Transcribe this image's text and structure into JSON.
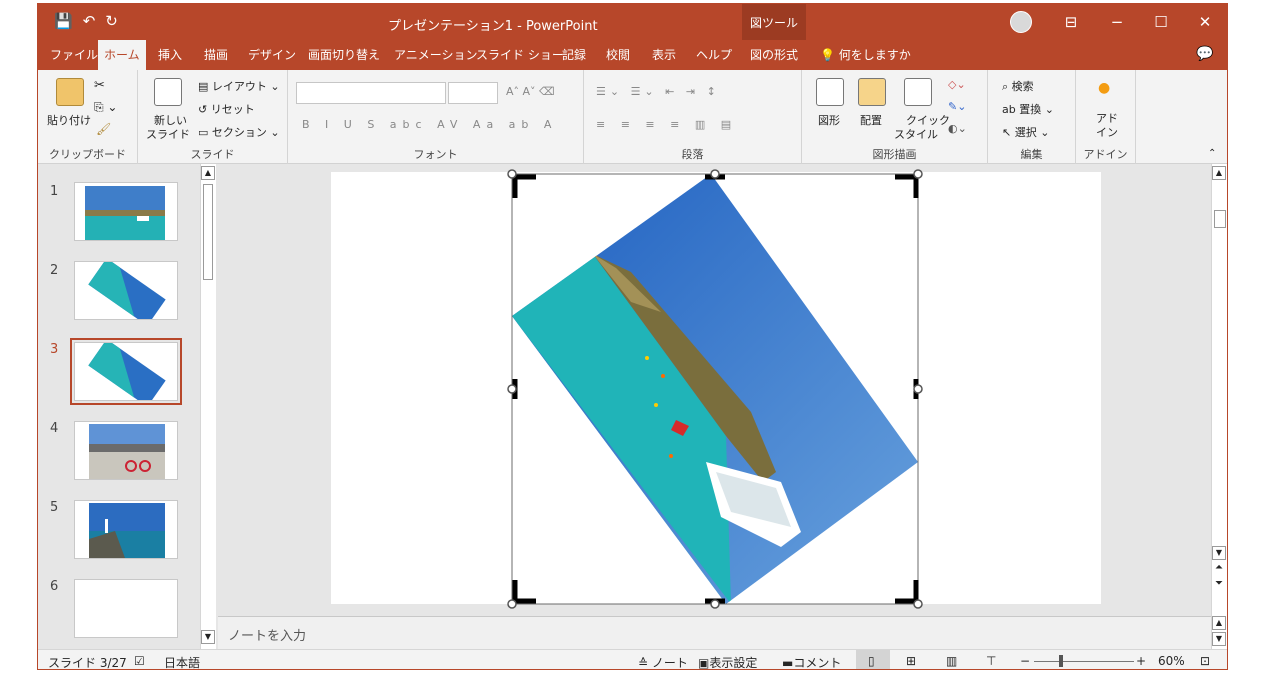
{
  "titlebar": {
    "doc_title": "プレゼンテーション1 - PowerPoint",
    "context_tab": "図ツール",
    "qat_save": "💾",
    "qat_undo": "↶",
    "qat_redo": "↻",
    "minimize": "−",
    "restore": "☐",
    "close": "✕",
    "display_options": "⊟"
  },
  "tabs": [
    "ファイル",
    "ホーム",
    "挿入",
    "描画",
    "デザイン",
    "画面切り替え",
    "アニメーション",
    "スライド ショー",
    "記録",
    "校閲",
    "表示",
    "ヘルプ",
    "図の形式"
  ],
  "active_tab": "ホーム",
  "tell_me": "何をしますか",
  "ribbon": {
    "clipboard": {
      "label": "クリップボード",
      "paste": "貼り付け"
    },
    "slides": {
      "label": "スライド",
      "new_slide_1": "新しい",
      "new_slide_2": "スライド",
      "layout": "レイアウト",
      "reset": "リセット",
      "section": "セクション"
    },
    "font": {
      "label": "フォント"
    },
    "paragraph": {
      "label": "段落"
    },
    "drawing": {
      "label": "図形描画",
      "shapes": "図形",
      "arrange": "配置",
      "quick_styles_1": "クイック",
      "quick_styles_2": "スタイル"
    },
    "editing": {
      "label": "編集",
      "find": "検索",
      "replace": "置換",
      "select": "選択"
    },
    "addins": {
      "label": "アドイン",
      "addin_1": "アド",
      "addin_2": "イン"
    }
  },
  "slides": [
    {
      "num": "1",
      "kind": "landscape"
    },
    {
      "num": "2",
      "kind": "rotated"
    },
    {
      "num": "3",
      "kind": "rotated"
    },
    {
      "num": "4",
      "kind": "bike"
    },
    {
      "num": "5",
      "kind": "lighthouse"
    },
    {
      "num": "6",
      "kind": "blank"
    }
  ],
  "selected_slide": 3,
  "notes_placeholder": "ノートを入力",
  "status": {
    "slide_counter": "スライド 3/27",
    "language": "日本語",
    "notes_button": "ノート",
    "display_settings": "表示設定",
    "comments_button": "コメント",
    "zoom": "60%"
  },
  "colors": {
    "accent": "#b7472a",
    "ribbon_bg": "#f3f3f3",
    "sea": "#22b3b8",
    "sky": "#2a6fc4"
  }
}
